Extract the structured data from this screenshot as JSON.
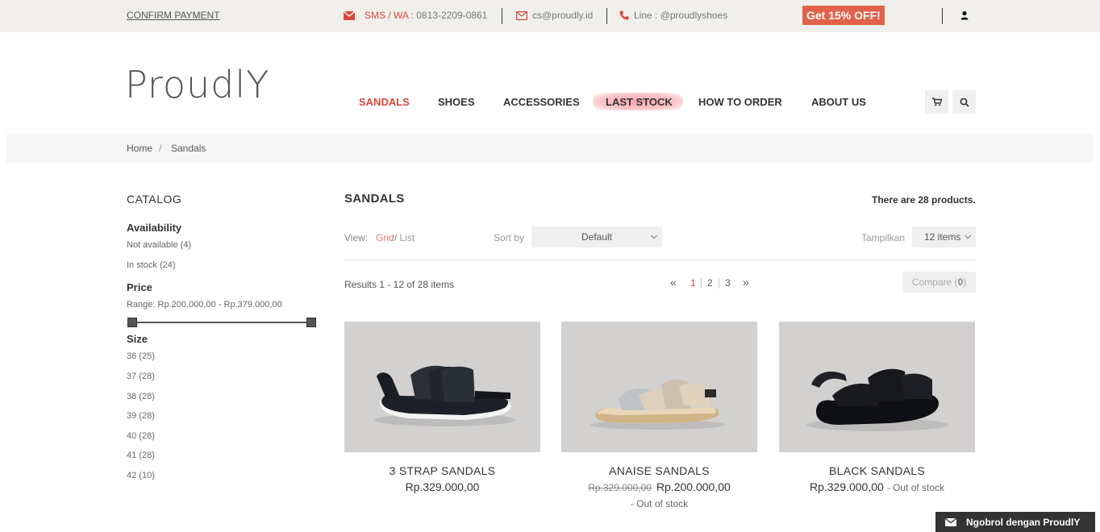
{
  "topbar": {
    "confirm_payment": "CONFIRM PAYMENT",
    "sms_label": "SMS / WA :",
    "sms_number": "0813-2209-0861",
    "email": "cs@proudly.id",
    "line": "Line : @proudlyshoes",
    "promo": "Get 15% OFF!"
  },
  "logo": "ProudlY",
  "nav": {
    "items": [
      "SANDALS",
      "SHOES",
      "ACCESSORIES",
      "LAST STOCK",
      "HOW TO ORDER",
      "ABOUT US"
    ],
    "active": "SANDALS"
  },
  "breadcrumb": {
    "home": "Home",
    "separator": "/",
    "current": "Sandals"
  },
  "sidebar": {
    "title": "CATALOG",
    "availability": {
      "heading": "Availability",
      "items": [
        "Not available (4)",
        "In stock (24)"
      ]
    },
    "price": {
      "heading": "Price",
      "range": "Range: Rp.200.000,00 - Rp.379.000,00"
    },
    "size": {
      "heading": "Size",
      "items": [
        "36 (25)",
        "37 (28)",
        "38 (28)",
        "39 (28)",
        "40 (28)",
        "41 (28)",
        "42 (10)"
      ]
    }
  },
  "category": {
    "title": "SANDALS",
    "count": "There are 28 products.",
    "view_label": "View:",
    "view_grid": "Grid",
    "view_slash": "/",
    "view_list": "List",
    "sort_label": "Sort by",
    "sort_value": "Default",
    "show_label": "Tampilkan",
    "show_value": "12 items",
    "results": "Results 1 - 12 of 28 items",
    "pager": {
      "prev": "«",
      "pages": [
        "1",
        "2",
        "3"
      ],
      "next": "»",
      "current": "1"
    },
    "compare_label": "Compare (",
    "compare_count": "0",
    "compare_close": ")"
  },
  "products": [
    {
      "name": "3 STRAP SANDALS",
      "price": "Rp.329.000,00",
      "old_price": "",
      "status": ""
    },
    {
      "name": "ANAISE SANDALS",
      "price": "Rp.200.000,00",
      "old_price": "Rp.329.000,00",
      "status": "- Out of stock"
    },
    {
      "name": "BLACK SANDALS",
      "price": "Rp.329.000,00",
      "old_price": "",
      "status": "- Out of stock"
    }
  ],
  "chat": {
    "label": "Ngobrol dengan ProudlY"
  },
  "colors": {
    "accent": "#d9473a",
    "promo": "#e1624a",
    "highlight": "#f7a5ac",
    "topbar": "#f0efeb"
  },
  "icons": [
    "envelope-icon",
    "phone-icon",
    "user-icon",
    "cart-icon",
    "search-icon"
  ]
}
